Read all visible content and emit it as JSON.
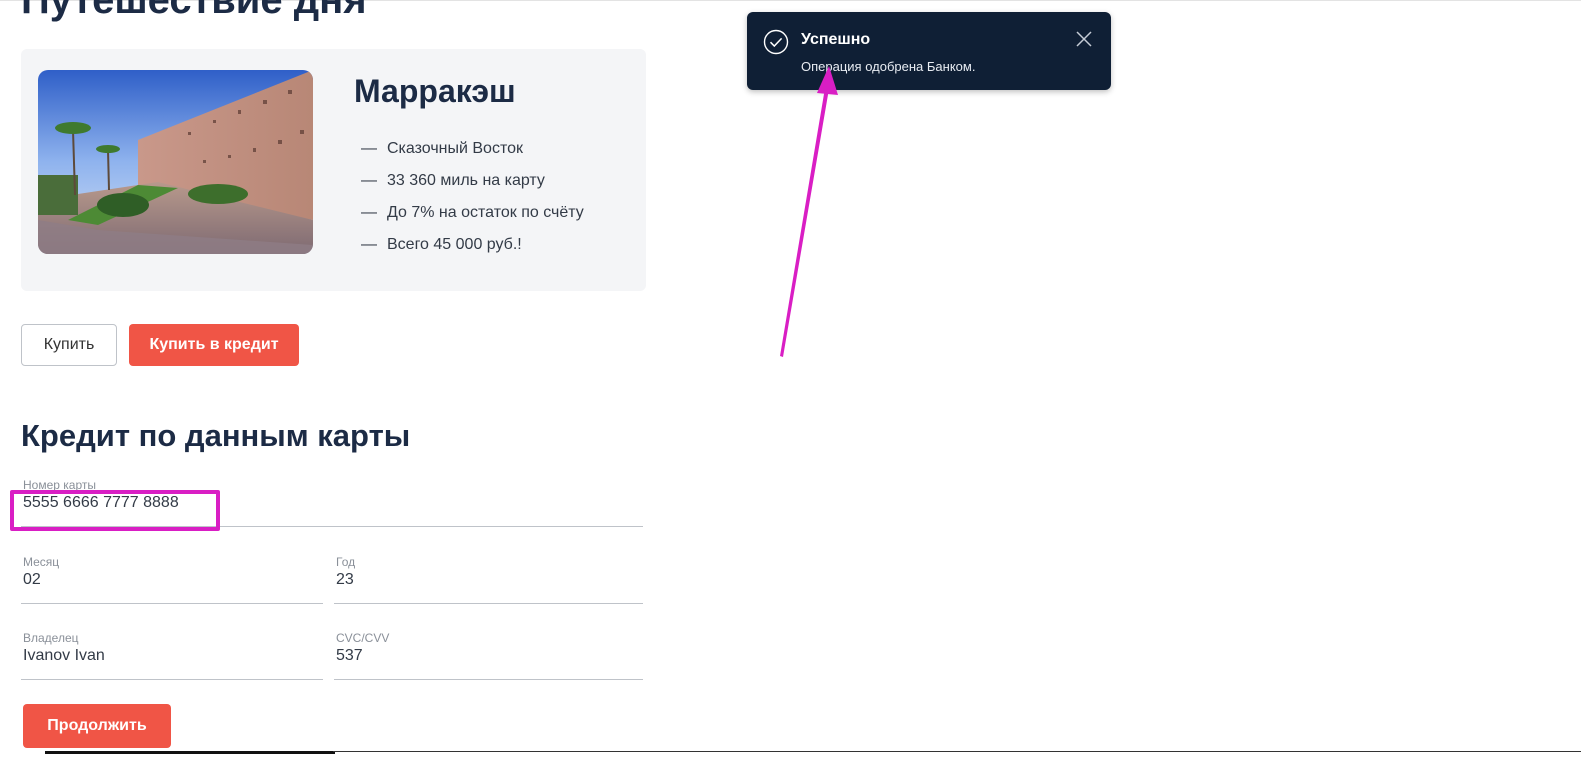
{
  "page": {
    "title": "Путешествие дня"
  },
  "tour": {
    "city": "Марракэш",
    "image_alt": "marrakech-wall-photo",
    "features": [
      {
        "dash": "—",
        "text": "Сказочный Восток"
      },
      {
        "dash": "—",
        "text": "33 360 миль на карту"
      },
      {
        "dash": "—",
        "text": "До 7% на остаток по счёту"
      },
      {
        "dash": "—",
        "text": "Всего 45 000 руб.!"
      }
    ]
  },
  "actions": {
    "buy_label": "Купить",
    "buy_credit_label": "Купить в кредит"
  },
  "form": {
    "title": "Кредит по данным карты",
    "card_number": {
      "label": "Номер карты",
      "value": "5555 6666 7777 8888"
    },
    "month": {
      "label": "Месяц",
      "value": "02"
    },
    "year": {
      "label": "Год",
      "value": "23"
    },
    "owner": {
      "label": "Владелец",
      "value": "Ivanov Ivan"
    },
    "cvc": {
      "label": "CVC/CVV",
      "value": "537"
    },
    "continue_label": "Продолжить"
  },
  "notification": {
    "title": "Успешно",
    "message": "Операция одобрена Банком.",
    "icon": "check-circle-icon",
    "close_icon": "close-icon"
  },
  "annotation": {
    "highlight_color": "#d91ec4",
    "arrow_color": "#d91ec4"
  },
  "colors": {
    "accent": "#f05546",
    "heading": "#1c2b45",
    "toast_bg": "#0f1f35"
  }
}
